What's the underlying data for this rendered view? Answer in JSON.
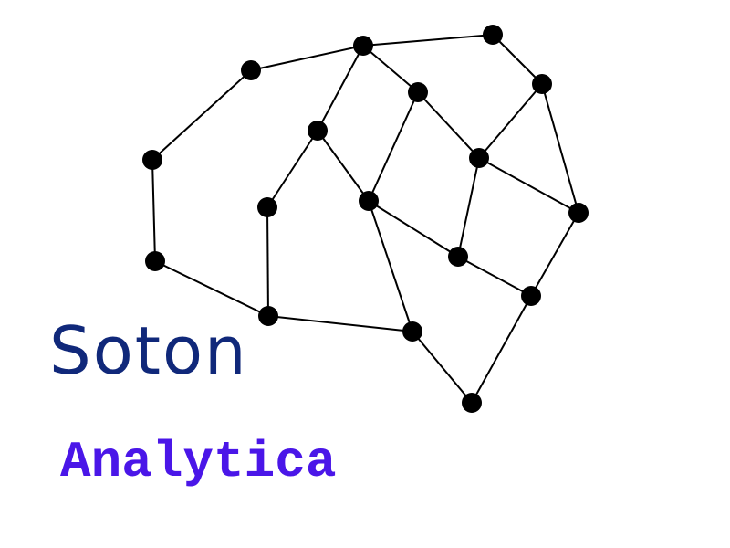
{
  "logo": {
    "line1": "Soton",
    "line2": "Analytica",
    "graphic": "brain-network-graph-icon",
    "colors": {
      "line1": "#10287a",
      "line2": "#4a16e8",
      "nodes": "#000000",
      "edges": "#000000",
      "background": "#ffffff"
    }
  }
}
